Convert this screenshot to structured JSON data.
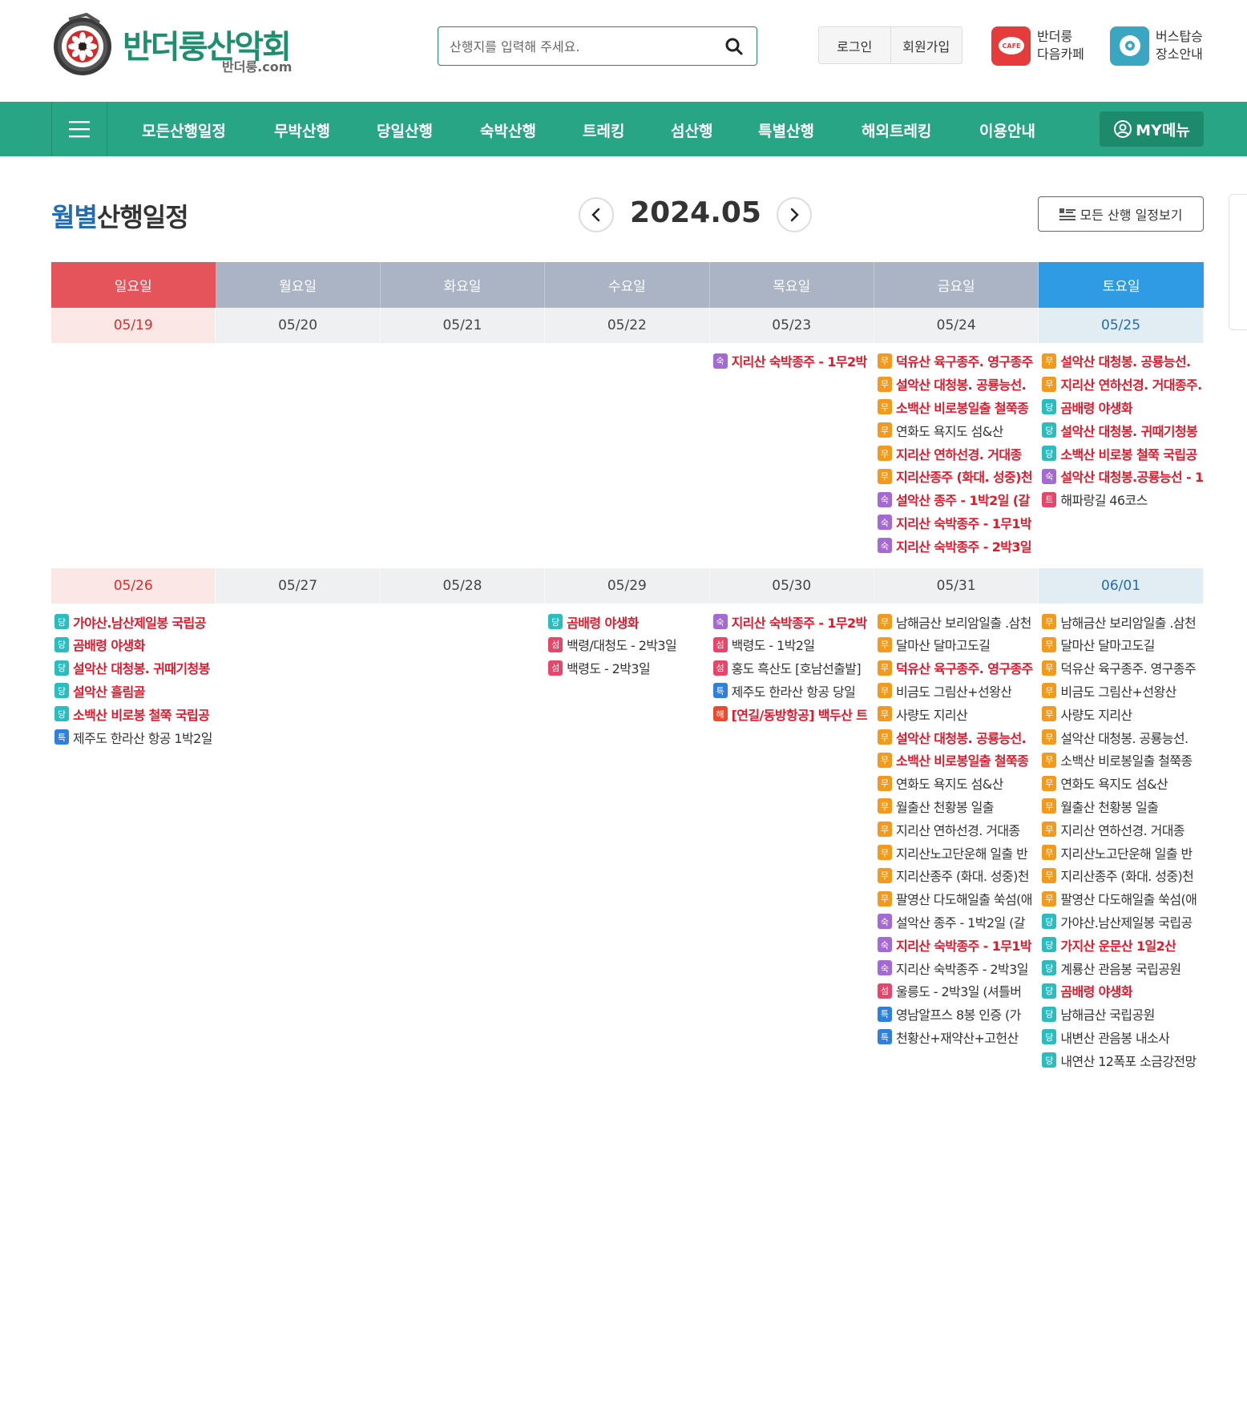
{
  "site": {
    "name": "반더룽산악회",
    "domain": "반더룽.com"
  },
  "search": {
    "placeholder": "산행지를 입력해 주세요."
  },
  "auth": {
    "login": "로그인",
    "signup": "회원가입"
  },
  "quick_links": [
    {
      "line1": "반더룽",
      "line2": "다음카페",
      "icon_text": "CAFE"
    },
    {
      "line1": "버스탑승",
      "line2": "장소안내"
    }
  ],
  "nav": {
    "items": [
      "모든산행일정",
      "무박산행",
      "당일산행",
      "숙박산행",
      "트레킹",
      "섬산행",
      "특별산행",
      "해외트레킹",
      "이용안내"
    ],
    "my_menu": "MY메뉴"
  },
  "calendar": {
    "title_accent": "월별",
    "title_rest": "산행일정",
    "month": "2024.05",
    "all_button": "모든 산행 일정보기",
    "weekdays": [
      "일요일",
      "월요일",
      "화요일",
      "수요일",
      "목요일",
      "금요일",
      "토요일"
    ],
    "badge_colors": {
      "무": "#f39a1e",
      "당": "#2bbcc0",
      "숙": "#a569d6",
      "섬": "#e8456b",
      "특": "#2f7fde",
      "트": "#e8456b",
      "해": "#ef4a2e"
    },
    "weeks": [
      {
        "dates": [
          "05/19",
          "05/20",
          "05/21",
          "05/22",
          "05/23",
          "05/24",
          "05/25"
        ],
        "days": [
          [],
          [],
          [],
          [],
          [
            {
              "b": "숙",
              "t": "지리산 숙박종주 - 1무2박",
              "hot": true
            }
          ],
          [
            {
              "b": "무",
              "t": "덕유산 육구종주. 영구종주",
              "hot": true
            },
            {
              "b": "무",
              "t": "설악산 대청봉. 공룡능선.",
              "hot": true
            },
            {
              "b": "무",
              "t": "소백산 비로봉일출 철쭉종",
              "hot": true
            },
            {
              "b": "무",
              "t": "연화도 욕지도 섬&산",
              "hot": false
            },
            {
              "b": "무",
              "t": "지리산 연하선경. 거대종",
              "hot": true
            },
            {
              "b": "무",
              "t": "지리산종주 (화대. 성중)천",
              "hot": true
            },
            {
              "b": "숙",
              "t": "설악산 종주 - 1박2일 (갈",
              "hot": true
            },
            {
              "b": "숙",
              "t": "지리산 숙박종주 - 1무1박",
              "hot": true
            },
            {
              "b": "숙",
              "t": "지리산 숙박종주 - 2박3일",
              "hot": true
            }
          ],
          [
            {
              "b": "무",
              "t": "설악산 대청봉. 공룡능선.",
              "hot": true
            },
            {
              "b": "무",
              "t": "지리산 연하선경. 거대종주.",
              "hot": true
            },
            {
              "b": "당",
              "t": "곰배령 야생화",
              "hot": true
            },
            {
              "b": "당",
              "t": "설악산 대청봉. 귀때기청봉",
              "hot": true
            },
            {
              "b": "당",
              "t": "소백산 비로봉 철쭉 국립공",
              "hot": true
            },
            {
              "b": "숙",
              "t": "설악산 대청봉.공룡능선 - 1",
              "hot": true
            },
            {
              "b": "트",
              "t": "해파랑길 46코스",
              "hot": false
            }
          ]
        ]
      },
      {
        "dates": [
          "05/26",
          "05/27",
          "05/28",
          "05/29",
          "05/30",
          "05/31",
          "06/01"
        ],
        "days": [
          [
            {
              "b": "당",
              "t": "가야산.남산제일봉 국립공",
              "hot": true
            },
            {
              "b": "당",
              "t": "곰배령 야생화",
              "hot": true
            },
            {
              "b": "당",
              "t": "설악산 대청봉. 귀때기청봉",
              "hot": true
            },
            {
              "b": "당",
              "t": "설악산 흘림골",
              "hot": true
            },
            {
              "b": "당",
              "t": "소백산 비로봉 철쭉 국립공",
              "hot": true
            },
            {
              "b": "특",
              "t": "제주도 한라산 항공 1박2일",
              "hot": false
            }
          ],
          [],
          [],
          [
            {
              "b": "당",
              "t": "곰배령 야생화",
              "hot": true
            },
            {
              "b": "섬",
              "t": "백령/대청도 - 2박3일",
              "hot": false
            },
            {
              "b": "섬",
              "t": "백령도 - 2박3일",
              "hot": false
            }
          ],
          [
            {
              "b": "숙",
              "t": "지리산 숙박종주 - 1무2박",
              "hot": true
            },
            {
              "b": "섬",
              "t": "백령도 - 1박2일",
              "hot": false
            },
            {
              "b": "섬",
              "t": "홍도 흑산도 [호남선출발]",
              "hot": false
            },
            {
              "b": "특",
              "t": "제주도 한라산 항공 당일",
              "hot": false
            },
            {
              "b": "해",
              "t": "[연길/동방항공] 백두산 트",
              "hot": true
            }
          ],
          [
            {
              "b": "무",
              "t": "남해금산 보리암일출 .삼천",
              "hot": false
            },
            {
              "b": "무",
              "t": "달마산 달마고도길",
              "hot": false
            },
            {
              "b": "무",
              "t": "덕유산 육구종주. 영구종주",
              "hot": true
            },
            {
              "b": "무",
              "t": "비금도 그림산+선왕산",
              "hot": false
            },
            {
              "b": "무",
              "t": "사량도 지리산",
              "hot": false
            },
            {
              "b": "무",
              "t": "설악산 대청봉. 공룡능선.",
              "hot": true
            },
            {
              "b": "무",
              "t": "소백산 비로봉일출 철쭉종",
              "hot": true
            },
            {
              "b": "무",
              "t": "연화도 욕지도 섬&산",
              "hot": false
            },
            {
              "b": "무",
              "t": "월출산 천황봉 일출",
              "hot": false
            },
            {
              "b": "무",
              "t": "지리산 연하선경. 거대종",
              "hot": false
            },
            {
              "b": "무",
              "t": "지리산노고단운해 일출 반",
              "hot": false
            },
            {
              "b": "무",
              "t": "지리산종주 (화대. 성중)천",
              "hot": false
            },
            {
              "b": "무",
              "t": "팔영산 다도해일출 쑥섬(애",
              "hot": false
            },
            {
              "b": "숙",
              "t": "설악산 종주 - 1박2일 (갈",
              "hot": false
            },
            {
              "b": "숙",
              "t": "지리산 숙박종주 - 1무1박",
              "hot": true
            },
            {
              "b": "숙",
              "t": "지리산 숙박종주 - 2박3일",
              "hot": false
            },
            {
              "b": "섬",
              "t": "울릉도 - 2박3일 (셔틀버",
              "hot": false
            },
            {
              "b": "특",
              "t": "영남알프스 8봉 인증 (가",
              "hot": false
            },
            {
              "b": "특",
              "t": "천황산+재약산+고헌산",
              "hot": false
            }
          ],
          [
            {
              "b": "무",
              "t": "남해금산 보리암일출 .삼천",
              "hot": false
            },
            {
              "b": "무",
              "t": "달마산 달마고도길",
              "hot": false
            },
            {
              "b": "무",
              "t": "덕유산 육구종주. 영구종주",
              "hot": false
            },
            {
              "b": "무",
              "t": "비금도 그림산+선왕산",
              "hot": false
            },
            {
              "b": "무",
              "t": "사량도 지리산",
              "hot": false
            },
            {
              "b": "무",
              "t": "설악산 대청봉. 공룡능선.",
              "hot": false
            },
            {
              "b": "무",
              "t": "소백산 비로봉일출 철쭉종",
              "hot": false
            },
            {
              "b": "무",
              "t": "연화도 욕지도 섬&산",
              "hot": false
            },
            {
              "b": "무",
              "t": "월출산 천황봉 일출",
              "hot": false
            },
            {
              "b": "무",
              "t": "지리산 연하선경. 거대종",
              "hot": false
            },
            {
              "b": "무",
              "t": "지리산노고단운해 일출 반",
              "hot": false
            },
            {
              "b": "무",
              "t": "지리산종주 (화대. 성중)천",
              "hot": false
            },
            {
              "b": "무",
              "t": "팔영산 다도해일출 쑥섬(애",
              "hot": false
            },
            {
              "b": "당",
              "t": "가야산.남산제일봉 국립공",
              "hot": false
            },
            {
              "b": "당",
              "t": "가지산 운문산 1일2산",
              "hot": true
            },
            {
              "b": "당",
              "t": "계룡산 관음봉 국립공원",
              "hot": false
            },
            {
              "b": "당",
              "t": "곰배령 야생화",
              "hot": true
            },
            {
              "b": "당",
              "t": "남해금산 국립공원",
              "hot": false
            },
            {
              "b": "당",
              "t": "내변산 관음봉 내소사",
              "hot": false
            },
            {
              "b": "당",
              "t": "내연산 12폭포 소금강전망",
              "hot": false
            }
          ]
        ]
      }
    ]
  }
}
